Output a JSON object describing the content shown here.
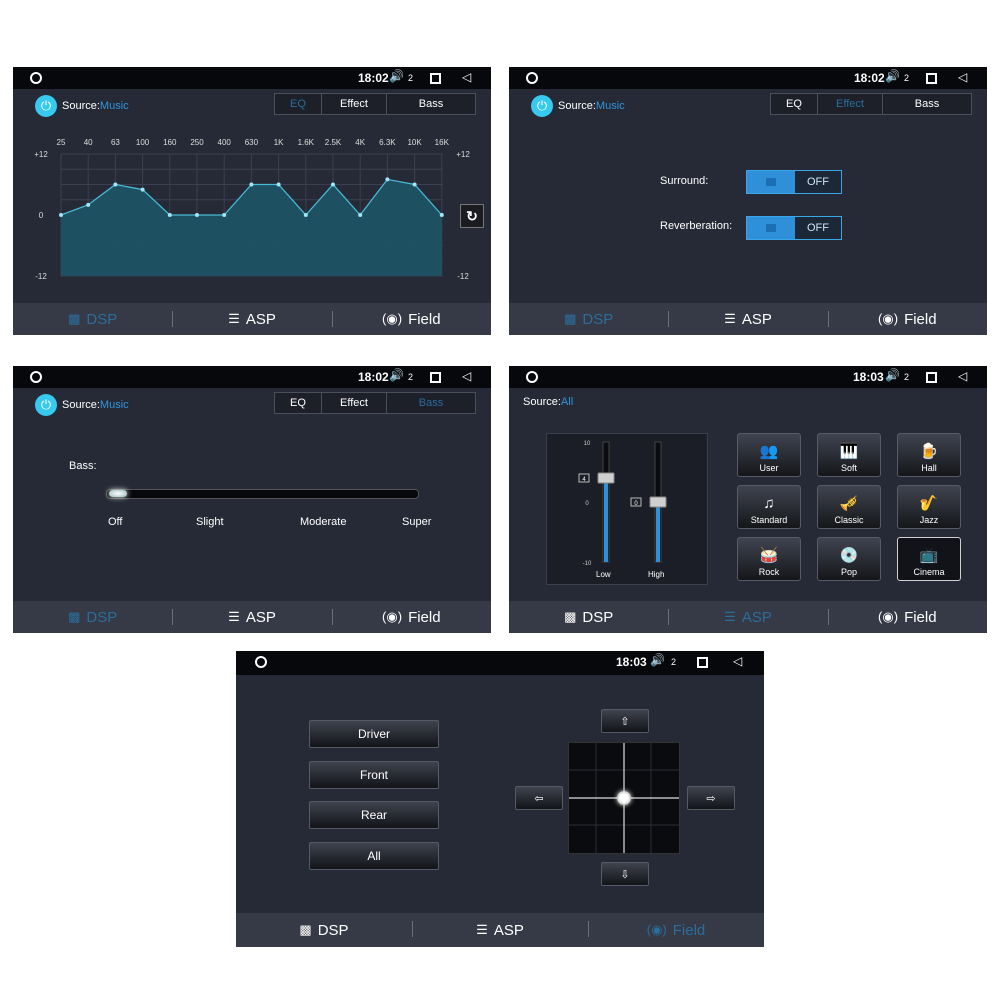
{
  "status": {
    "time1": "18:02",
    "time2": "18:03",
    "vol_icon": "speaker-icon",
    "vol_level": "2"
  },
  "source": {
    "label": "Source:",
    "music": "Music",
    "all": "All"
  },
  "tabs": {
    "eq": "EQ",
    "effect": "Effect",
    "bass": "Bass"
  },
  "bottom": {
    "dsp": "DSP",
    "asp": "ASP",
    "field": "Field"
  },
  "eq": {
    "freqs": [
      "25",
      "40",
      "63",
      "100",
      "160",
      "250",
      "400",
      "630",
      "1K",
      "1.6K",
      "2.5K",
      "4K",
      "6.3K",
      "10K",
      "16K"
    ],
    "levels": [
      0,
      2,
      6,
      5,
      0,
      0,
      0,
      6,
      6,
      0,
      6,
      0,
      7,
      6,
      0
    ],
    "scale": {
      "top": "+12",
      "mid": "0",
      "bottom": "-12"
    },
    "fill_color": "#1c5263",
    "line_color": "#48b9d8"
  },
  "effect": {
    "surround": "Surround:",
    "reverberation": "Reverberation:",
    "off": "OFF"
  },
  "bass": {
    "label": "Bass:",
    "levels": [
      "Off",
      "Slight",
      "Moderate",
      "Super"
    ],
    "selected": "Off"
  },
  "asp": {
    "low_label": "Low",
    "high_label": "High",
    "low_value": "4",
    "high_value": "0",
    "scale_top": "10",
    "scale_mid": "0",
    "scale_bottom": "-10",
    "low_level": 4,
    "high_level": 0,
    "presets": [
      "User",
      "Soft",
      "Hall",
      "Standard",
      "Classic",
      "Jazz",
      "Rock",
      "Pop",
      "Cinema"
    ],
    "selected": "Cinema"
  },
  "field": {
    "buttons": [
      "Driver",
      "Front",
      "Rear",
      "All"
    ]
  },
  "colors": {
    "accent": "#2f95dc",
    "power": "#37c9ee",
    "panel": "#262a36"
  }
}
